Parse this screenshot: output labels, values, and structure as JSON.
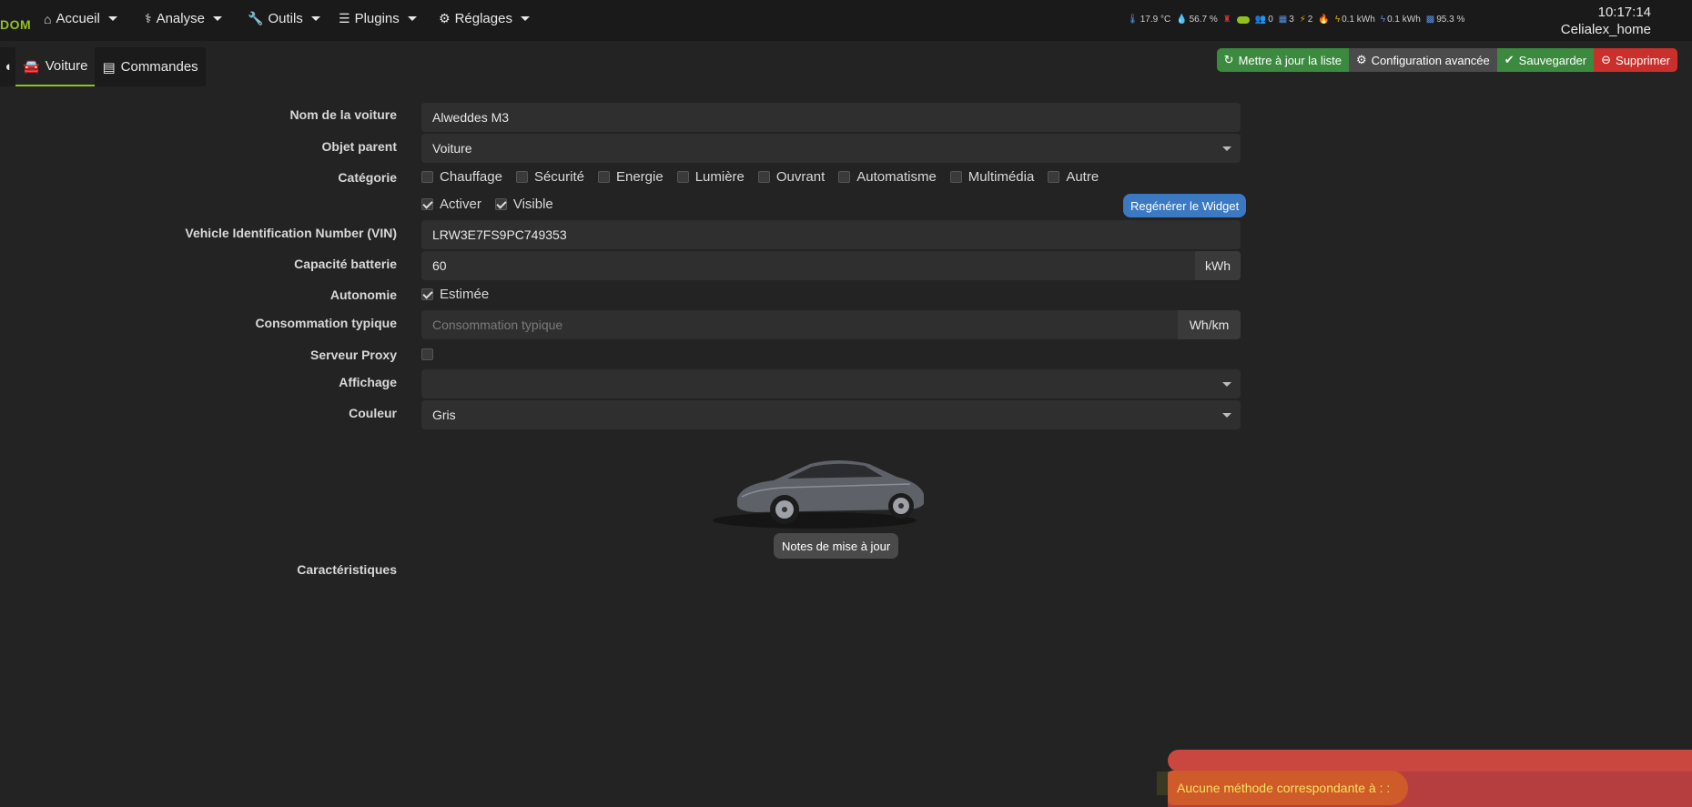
{
  "navbar": {
    "brand": "DOM",
    "items": [
      {
        "label": "Accueil",
        "icon": "home-icon"
      },
      {
        "label": "Analyse",
        "icon": "stethoscope-icon"
      },
      {
        "label": "Outils",
        "icon": "wrench-icon"
      },
      {
        "label": "Plugins",
        "icon": "list-icon"
      },
      {
        "label": "Réglages",
        "icon": "cogs-icon"
      }
    ],
    "status": {
      "temperature": "17.9 °C",
      "humidity": "56.7 %",
      "users": "0",
      "calendar": "3",
      "plugs": "2",
      "energy1": "0.1 kWh",
      "energy2": "0.1 kWh",
      "solar": "95.3 %"
    },
    "time": "10:17:14",
    "user": "Celialex_home"
  },
  "tabs": [
    {
      "label": "Voiture"
    },
    {
      "label": "Commandes"
    }
  ],
  "actions": {
    "refresh": "Mettre à jour la liste",
    "advanced": "Configuration avancée",
    "save": "Sauvegarder",
    "delete": "Supprimer"
  },
  "form": {
    "name_label": "Nom de la voiture",
    "name_value": "Alweddes M3",
    "parent_label": "Objet parent",
    "parent_value": "Voiture",
    "category_label": "Catégorie",
    "categories": [
      "Chauffage",
      "Sécurité",
      "Energie",
      "Lumière",
      "Ouvrant",
      "Automatisme",
      "Multimédia",
      "Autre"
    ],
    "activate": "Activer",
    "visible": "Visible",
    "regen": "Regénérer le Widget",
    "vin_label": "Vehicle Identification Number (VIN)",
    "vin_value": "LRW3E7FS9PC749353",
    "battery_label": "Capacité batterie",
    "battery_value": "60",
    "battery_unit": "kWh",
    "autonomy_label": "Autonomie",
    "autonomy_option": "Estimée",
    "consumption_label": "Consommation typique",
    "consumption_placeholder": "Consommation typique",
    "consumption_unit": "Wh/km",
    "proxy_label": "Serveur Proxy",
    "display_label": "Affichage",
    "display_value": "",
    "color_label": "Couleur",
    "color_value": "Gris",
    "notes_button": "Notes de mise à jour",
    "features_label": "Caractéristiques"
  },
  "alert": {
    "message": "Aucune méthode correspondante à : :"
  }
}
